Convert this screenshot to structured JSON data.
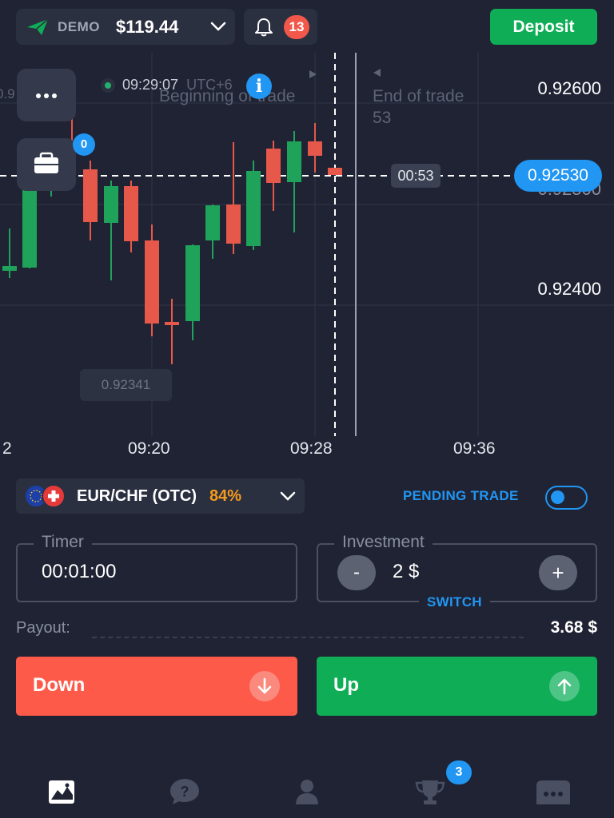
{
  "header": {
    "account_mode": "DEMO",
    "balance": "$119.44",
    "notifications_count": "13",
    "deposit_label": "Deposit"
  },
  "chart": {
    "clock_time": "09:29:07",
    "timezone": "UTC+6",
    "beginning_label": "Beginning of trade",
    "end_label": "End of trade",
    "end_value": "53",
    "price_labels": [
      "0.92600",
      "0.92500",
      "0.92400"
    ],
    "current_price": "0.92530",
    "countdown": "00:53",
    "low_price": "0.92341",
    "time_labels": [
      "2",
      "09:20",
      "09:28",
      "09:36"
    ],
    "left_price_partial": "0.9",
    "portfolio_count": "0"
  },
  "asset": {
    "name": "EUR/CHF (OTC)",
    "payout_percent": "84%"
  },
  "pending_trade_label": "PENDING TRADE",
  "timer": {
    "label": "Timer",
    "value": "00:01:00"
  },
  "investment": {
    "label": "Investment",
    "value": "2 $",
    "minus": "-",
    "plus": "+",
    "switch_label": "SWITCH"
  },
  "payout": {
    "label": "Payout:",
    "value": "3.68 $"
  },
  "actions": {
    "down_label": "Down",
    "up_label": "Up"
  },
  "nav": {
    "achievements_count": "3",
    "icons": [
      "chart-icon",
      "help-icon",
      "profile-icon",
      "trophy-icon",
      "more-icon"
    ]
  },
  "colors": {
    "background": "#1f2333",
    "accent": "#2196f3",
    "up": "#0fae56",
    "down": "#fe5a4a",
    "payout": "#f59a1e"
  }
}
